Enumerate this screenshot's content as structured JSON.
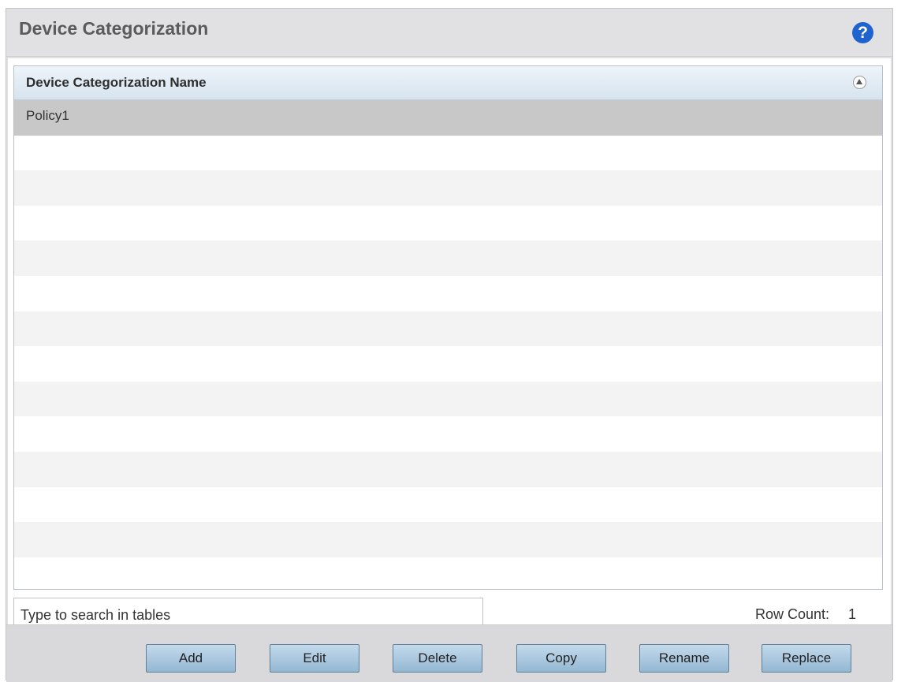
{
  "panel": {
    "title": "Device Categorization",
    "help_icon": "?"
  },
  "table": {
    "column_header": "Device Categorization Name",
    "collapse_icon": "collapse-up-icon",
    "rows": [
      "Policy1"
    ],
    "empty_rows": 13
  },
  "search": {
    "placeholder": "Type to search in tables",
    "value": ""
  },
  "row_count": {
    "label": "Row Count:",
    "value": "1"
  },
  "buttons": {
    "add": "Add",
    "edit": "Edit",
    "delete": "Delete",
    "copy": "Copy",
    "rename": "Rename",
    "replace": "Replace"
  },
  "colors": {
    "help_icon": "#1f63d0",
    "selected_row": "#c8c8c8",
    "button_fill": "#a9c9e2"
  }
}
